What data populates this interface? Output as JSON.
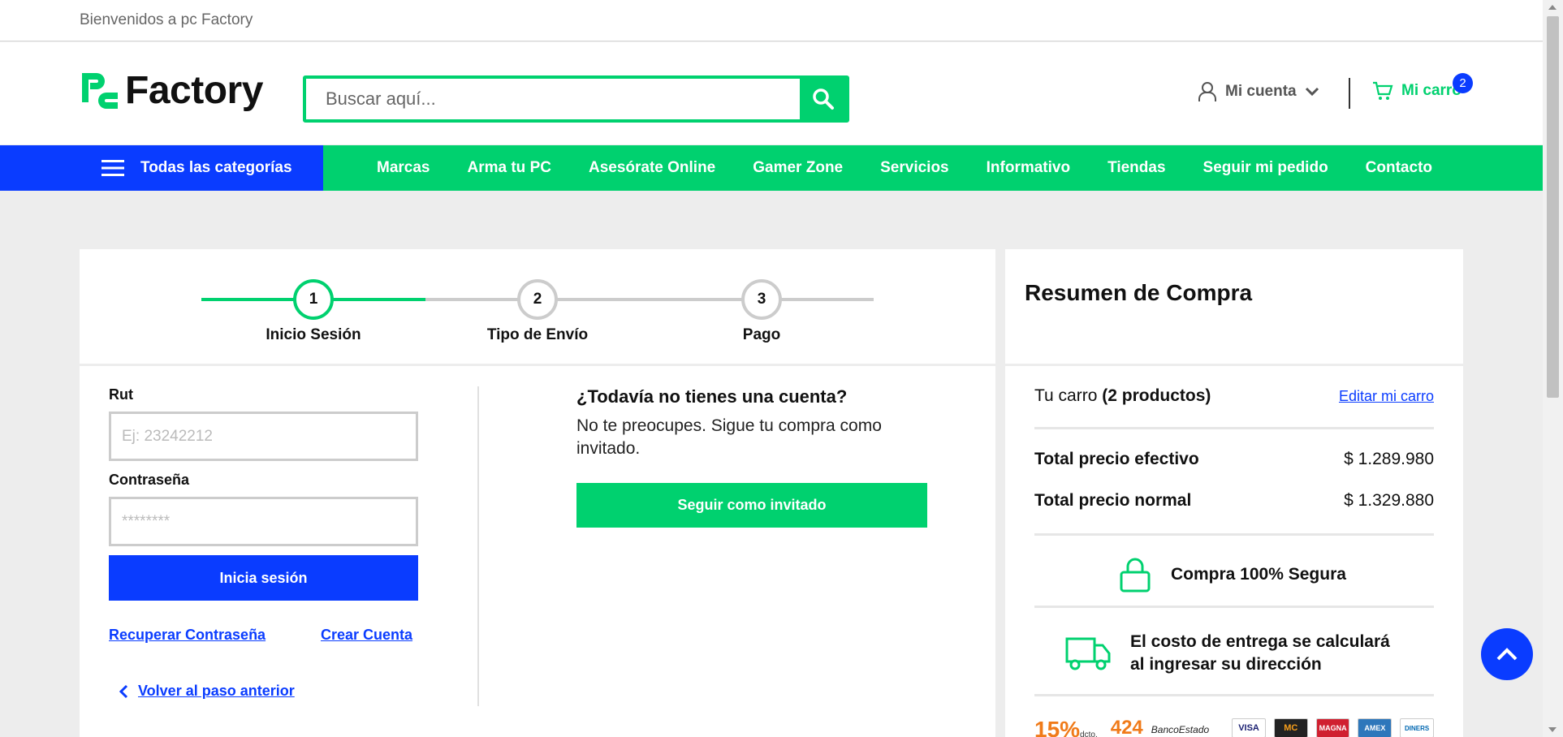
{
  "topbar": {
    "welcome": "Bienvenidos a pc Factory"
  },
  "header": {
    "logo_text": "Factory",
    "search_placeholder": "Buscar aquí...",
    "account_label": "Mi cuenta",
    "cart_label": "Mi carro",
    "cart_count": "2"
  },
  "nav": {
    "categories_label": "Todas las categorías",
    "links": [
      "Marcas",
      "Arma tu PC",
      "Asesórate Online",
      "Gamer Zone",
      "Servicios",
      "Informativo",
      "Tiendas",
      "Seguir mi pedido",
      "Contacto"
    ]
  },
  "steps": [
    {
      "number": "1",
      "label": "Inicio Sesión",
      "active": true
    },
    {
      "number": "2",
      "label": "Tipo de Envío",
      "active": false
    },
    {
      "number": "3",
      "label": "Pago",
      "active": false
    }
  ],
  "login": {
    "rut_label": "Rut",
    "rut_placeholder": "Ej: 23242212",
    "password_label": "Contraseña",
    "password_placeholder": "********",
    "submit_label": "Inicia sesión",
    "recover_link": "Recuperar Contraseña",
    "create_link": "Crear Cuenta",
    "back_link": "Volver al paso anterior"
  },
  "guest": {
    "title": "¿Todavía no tienes una cuenta?",
    "text": "No te preocupes. Sigue tu compra como invitado.",
    "button_label": "Seguir como invitado"
  },
  "summary": {
    "title": "Resumen de Compra",
    "cart_prefix": "Tu carro",
    "cart_products": "(2 productos)",
    "edit_link": "Editar mi carro",
    "cash_label": "Total precio efectivo",
    "cash_value": "$ 1.289.980",
    "normal_label": "Total precio normal",
    "normal_value": "$ 1.329.880",
    "secure_text": "Compra 100% Segura",
    "delivery_line1": "El costo de entrega se calculará",
    "delivery_line2": "al ingresar su dirección"
  },
  "payments": {
    "discount1": "15%",
    "discount1_note": "dcto.",
    "discount2": "424",
    "bank": "BancoEstado",
    "cards": [
      "VISA",
      "MC",
      "MAGNA",
      "AMEX",
      "DINERS"
    ]
  },
  "colors": {
    "green": "#00d16f",
    "blue": "#0a3cff",
    "background": "#ededed"
  }
}
